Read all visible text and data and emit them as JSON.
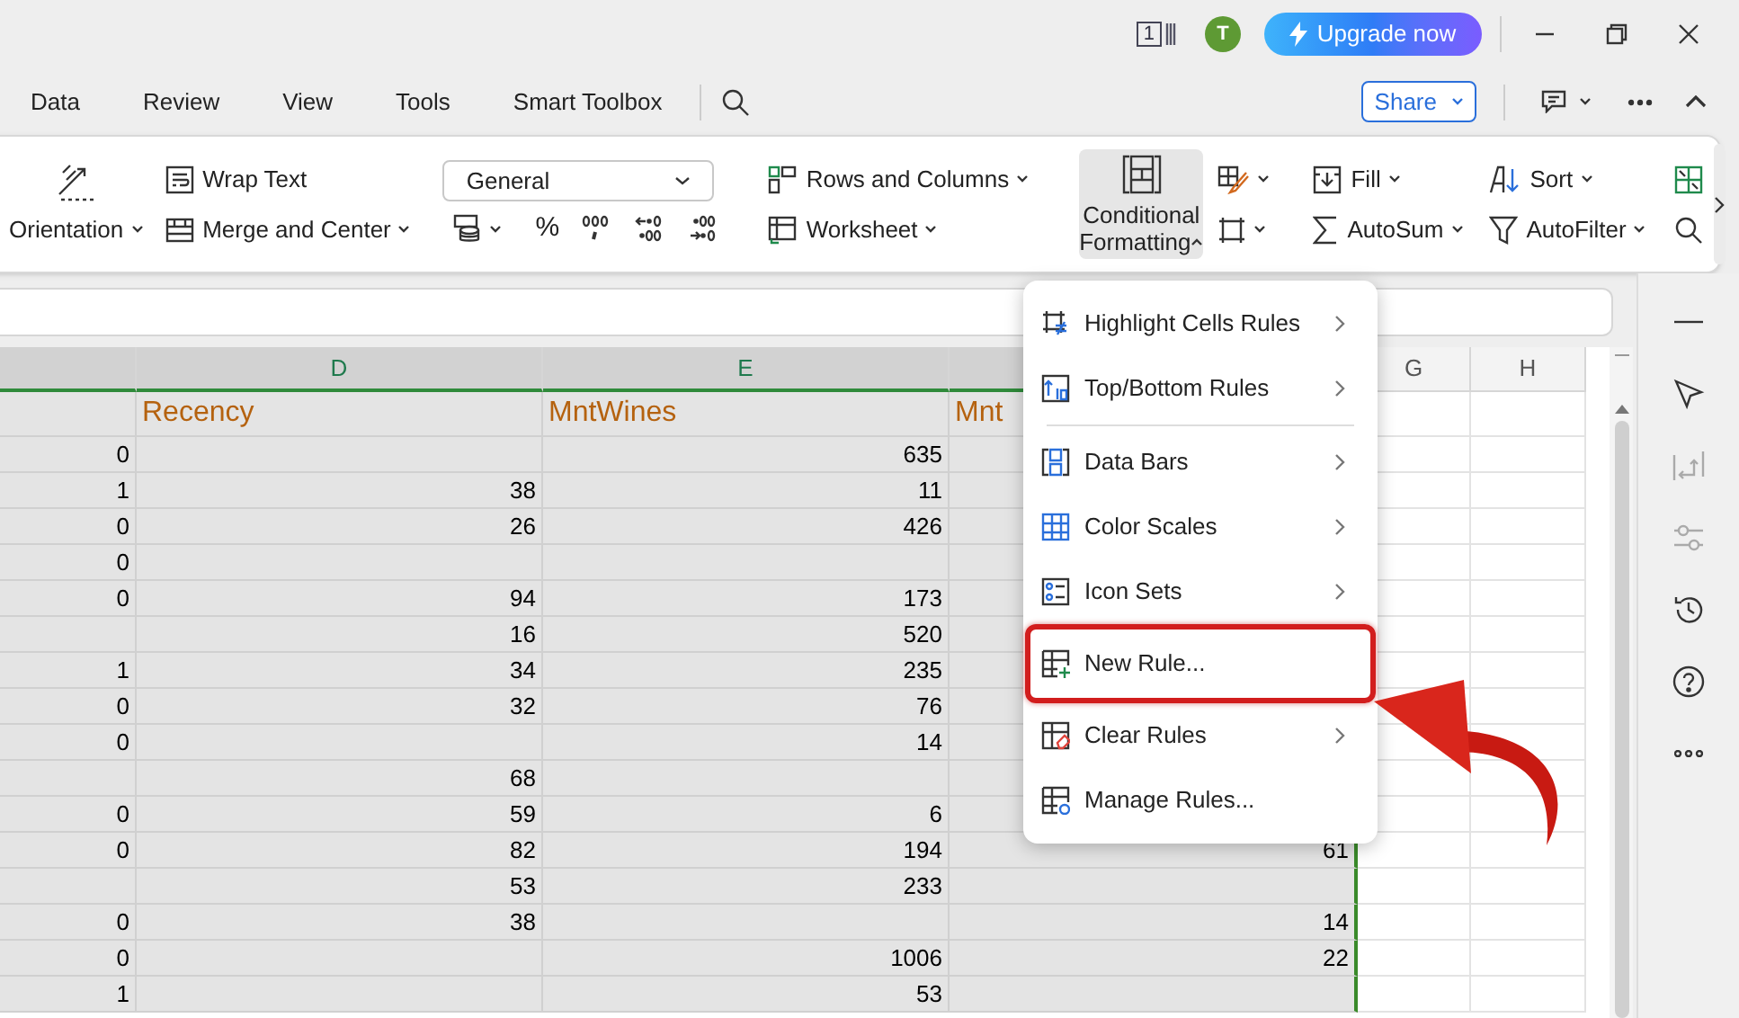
{
  "title_bar": {
    "window_count": "1",
    "avatar": "T",
    "upgrade_button": "Upgrade now"
  },
  "menu_tabs": [
    {
      "label": "Data"
    },
    {
      "label": "Review"
    },
    {
      "label": "View"
    },
    {
      "label": "Tools"
    },
    {
      "label": "Smart Toolbox"
    }
  ],
  "share_button": {
    "label": "Share",
    "dropdown": true
  },
  "ribbon": {
    "orientation": {
      "label": "Orientation",
      "dropdown": true
    },
    "wrap_text": {
      "label": "Wrap Text",
      "dropdown": false
    },
    "merge_and_center": {
      "label": "Merge and Center",
      "dropdown": true
    },
    "number_format": {
      "value": "General"
    },
    "percent": {
      "label": "%"
    },
    "rows_and_columns": {
      "label": "Rows and Columns",
      "dropdown": true
    },
    "worksheet": {
      "label": "Worksheet",
      "dropdown": true
    },
    "conditional_formatting": {
      "label_lines": [
        "Conditional",
        "Formatting"
      ],
      "pressed": true,
      "expanded": true
    },
    "fill": {
      "label": "Fill",
      "dropdown": true
    },
    "autosum": {
      "label": "AutoSum",
      "dropdown": true
    },
    "sort": {
      "label": "Sort",
      "dropdown": true
    },
    "autofilter": {
      "label": "AutoFilter",
      "dropdown": true
    }
  },
  "sheet": {
    "columns": [
      {
        "selected": true
      },
      {
        "letter": "D",
        "header": "Recency",
        "selected": true
      },
      {
        "letter": "E",
        "header": "MntWines",
        "selected": true
      },
      {
        "header": "Mnt",
        "selected": true
      },
      {
        "letter": "G",
        "selected": false
      },
      {
        "letter": "H",
        "selected": false
      }
    ],
    "rows": [
      {
        "column_c": "0",
        "mnt_wines": "635"
      },
      {
        "column_c": "1",
        "recency": "38",
        "mnt_wines": "11"
      },
      {
        "column_c": "0",
        "recency": "26",
        "mnt_wines": "426"
      },
      {
        "column_c": "0"
      },
      {
        "column_c": "0",
        "recency": "94",
        "mnt_wines": "173"
      },
      {
        "recency": "16",
        "mnt_wines": "520"
      },
      {
        "column_c": "1",
        "recency": "34",
        "mnt_wines": "235"
      },
      {
        "column_c": "0",
        "recency": "32",
        "mnt_wines": "76"
      },
      {
        "column_c": "0",
        "mnt_wines": "14"
      },
      {
        "recency": "68"
      },
      {
        "column_c": "0",
        "recency": "59",
        "mnt_wines": "6"
      },
      {
        "column_c": "0",
        "recency": "82",
        "mnt_wines": "194",
        "column_f": "61"
      },
      {
        "recency": "53",
        "mnt_wines": "233"
      },
      {
        "column_c": "0",
        "recency": "38",
        "column_f": "14"
      },
      {
        "column_c": "0",
        "mnt_wines": "1006",
        "column_f": "22"
      },
      {
        "column_c": "1",
        "mnt_wines": "53"
      }
    ]
  },
  "conditional_menu": [
    {
      "kind": "item",
      "label": "Highlight Cells Rules",
      "submenu": true,
      "highlighted": false
    },
    {
      "kind": "item",
      "label": "Top/Bottom Rules",
      "submenu": true,
      "highlighted": false
    },
    {
      "kind": "separator"
    },
    {
      "kind": "item",
      "label": "Data Bars",
      "submenu": true,
      "highlighted": false
    },
    {
      "kind": "item",
      "label": "Color Scales",
      "submenu": true,
      "highlighted": false
    },
    {
      "kind": "item",
      "label": "Icon Sets",
      "submenu": true,
      "highlighted": false
    },
    {
      "kind": "item",
      "label": "New Rule...",
      "submenu": false,
      "highlighted": true
    },
    {
      "kind": "item",
      "label": "Clear Rules",
      "submenu": true,
      "highlighted": false
    },
    {
      "kind": "item",
      "label": "Manage Rules...",
      "submenu": false,
      "highlighted": false
    }
  ]
}
